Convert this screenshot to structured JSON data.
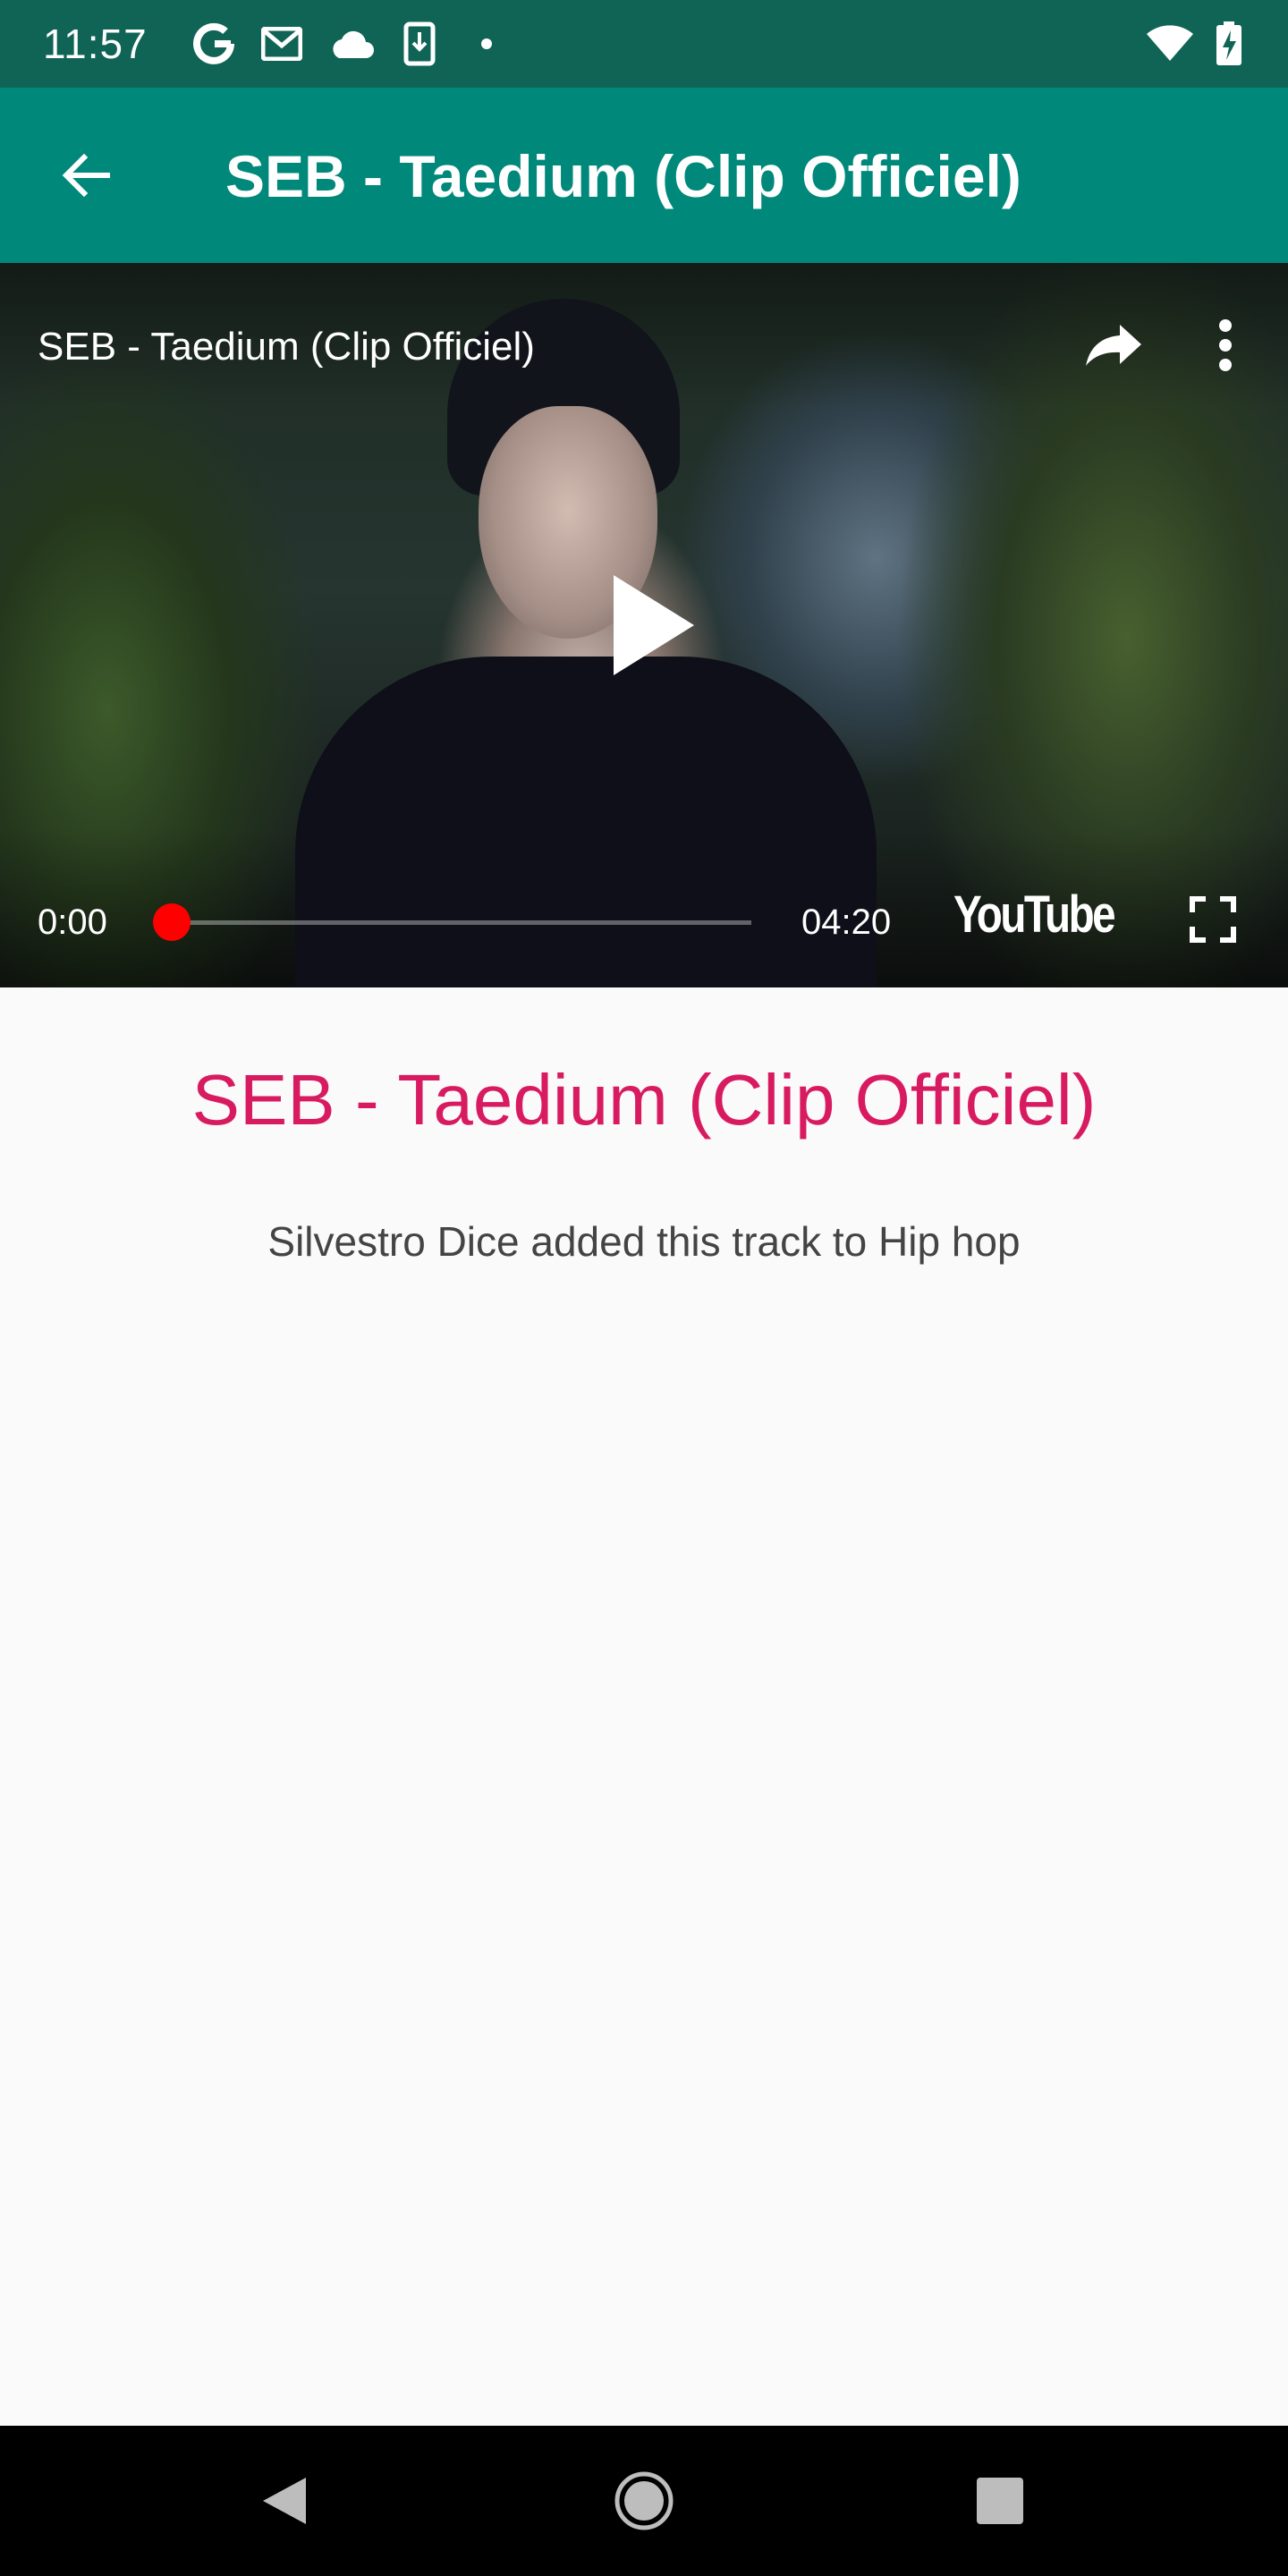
{
  "status_bar": {
    "time": "11:57",
    "icons": [
      "google-icon",
      "gmail-icon",
      "cloud-icon",
      "download-icon",
      "dot-icon",
      "wifi-icon",
      "battery-charging-icon"
    ]
  },
  "app_bar": {
    "title": "SEB - Taedium (Clip Officiel)",
    "back_icon": "arrow-back-icon"
  },
  "player": {
    "title": "SEB - Taedium (Clip Officiel)",
    "current_time": "0:00",
    "duration": "04:20",
    "progress": 0,
    "brand": "YouTube",
    "icons": [
      "share-icon",
      "more-vert-icon",
      "play-icon",
      "fullscreen-icon"
    ],
    "accent_color": "#ff0000"
  },
  "content": {
    "track_title": "SEB - Taedium (Clip Officiel)",
    "added_text": "Silvestro Dice added this track to Hip hop"
  },
  "nav_bar": {
    "icons": [
      "nav-back-icon",
      "nav-home-icon",
      "nav-recents-icon"
    ]
  },
  "colors": {
    "status_bar": "#0f6456",
    "app_bar": "#00897b",
    "title_accent": "#d81b60",
    "background": "#fafafa"
  }
}
